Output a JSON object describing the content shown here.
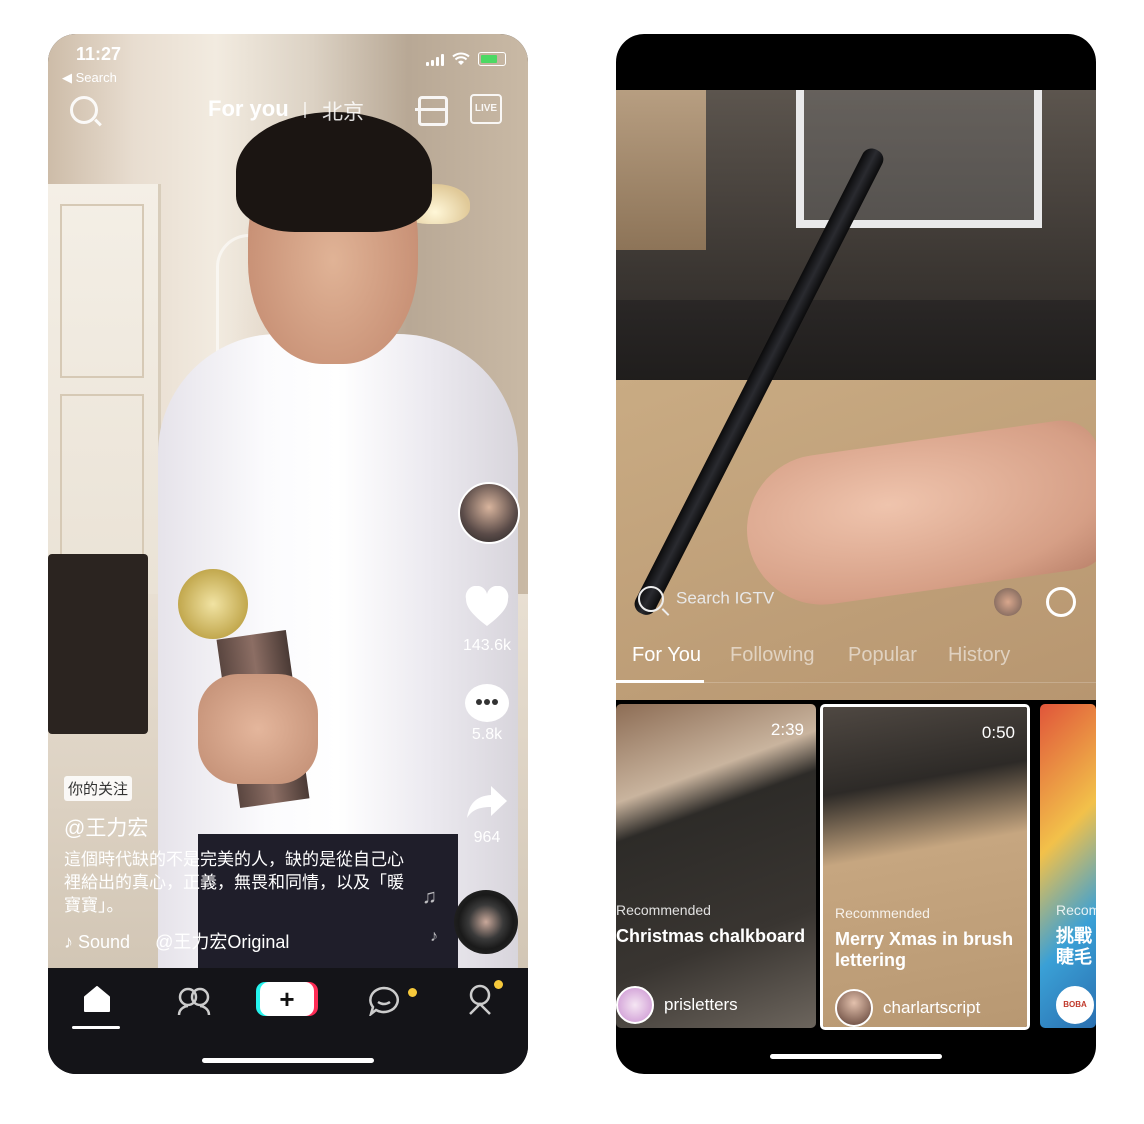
{
  "left_app": {
    "status": {
      "time": "11:27",
      "back_label": "◀ Search"
    },
    "top_tabs": {
      "for_you": "For you",
      "city": "北京",
      "live": "LIVE"
    },
    "side": {
      "likes": "143.6k",
      "comments": "5.8k",
      "shares": "964"
    },
    "follow_badge": "你的关注",
    "username": "@王力宏",
    "caption": "這個時代缺的不是完美的人，缺的是從自己心裡給出的真心，正義，無畏和同情，以及「暖寶寶」。",
    "sound": {
      "icon": "tiktok-note-icon",
      "label": "Sound",
      "track": "@王力宏Original"
    },
    "tab_bar": [
      "home-icon",
      "friends-icon",
      "create-icon",
      "inbox-icon",
      "profile-icon"
    ],
    "colors": {
      "accent_cyan": "#25f4ee",
      "accent_red": "#fe2c55",
      "notification_dot": "#f6c93b"
    }
  },
  "right_app": {
    "search_placeholder": "Search IGTV",
    "tabs": [
      "For You",
      "Following",
      "Popular",
      "History"
    ],
    "active_tab": "For You",
    "cards": [
      {
        "duration": "2:39",
        "label": "Recommended",
        "title": "Christmas chalkboard",
        "channel": "prisletters"
      },
      {
        "duration": "0:50",
        "label": "Recommended",
        "title": "Merry Xmas in brush lettering",
        "channel": "charlartscript"
      },
      {
        "label": "Recom",
        "title": "挑戰\n睫毛",
        "channel": "BOBA"
      }
    ]
  }
}
